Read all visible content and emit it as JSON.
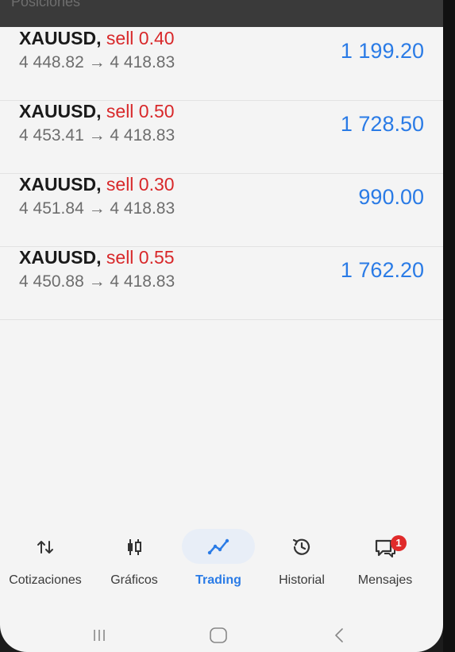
{
  "header": {
    "section_title": "Posiciones"
  },
  "positions": [
    {
      "symbol": "XAUUSD",
      "side": "sell 0.40",
      "prices": "4 448.82 → 4 418.83",
      "profit": "1 199.20"
    },
    {
      "symbol": "XAUUSD",
      "side": "sell 0.50",
      "prices": "4 453.41 → 4 418.83",
      "profit": "1 728.50"
    },
    {
      "symbol": "XAUUSD",
      "side": "sell 0.30",
      "prices": "4 451.84 → 4 418.83",
      "profit": "990.00"
    },
    {
      "symbol": "XAUUSD",
      "side": "sell 0.55",
      "prices": "4 450.88 → 4 418.83",
      "profit": "1 762.20"
    }
  ],
  "nav": {
    "items": [
      {
        "label": "Cotizaciones",
        "icon": "quotes-arrows-icon"
      },
      {
        "label": "Gráficos",
        "icon": "candlestick-icon"
      },
      {
        "label": "Trading",
        "icon": "trading-line-icon",
        "active": true
      },
      {
        "label": "Historial",
        "icon": "history-clock-icon"
      },
      {
        "label": "Mensajes",
        "icon": "messages-icon",
        "badge": "1"
      }
    ]
  },
  "colors": {
    "sell": "#d8282a",
    "profit": "#2a7be6",
    "active": "#2a7be6",
    "badge": "#e02a2a"
  }
}
